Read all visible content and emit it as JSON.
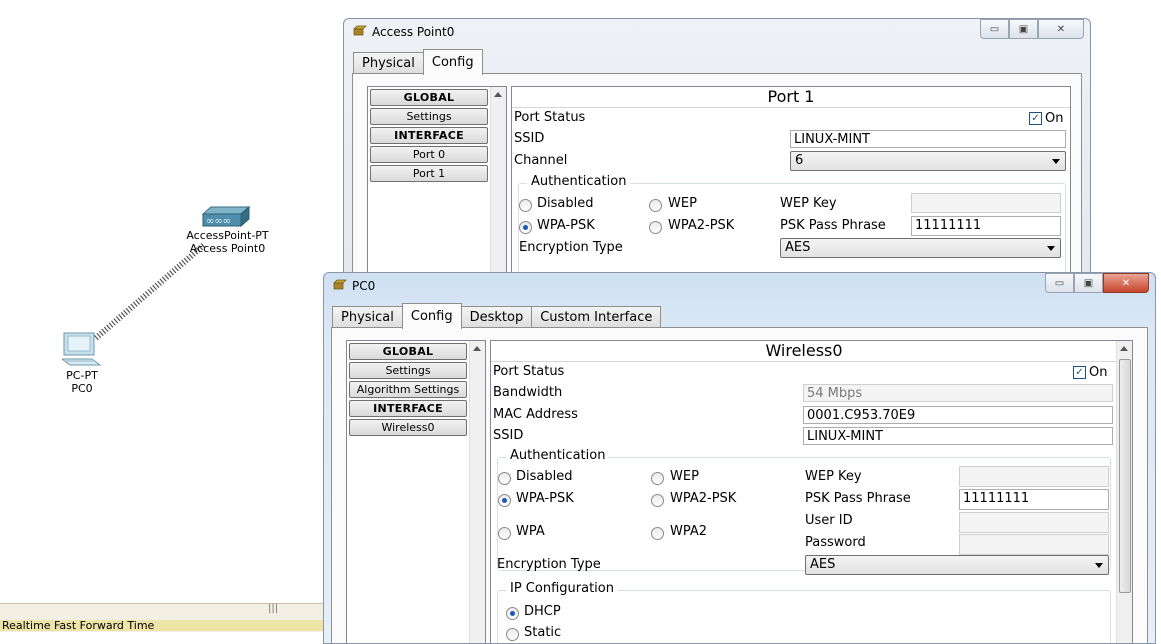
{
  "workspace": {
    "access_point_device": {
      "type_label": "AccessPoint-PT",
      "name_label": "Access Point0"
    },
    "pc_device": {
      "type_label": "PC-PT",
      "name_label": "PC0"
    },
    "statusbar_text": "Realtime  Fast Forward Time"
  },
  "ap_window": {
    "title": "Access Point0",
    "tabs": [
      "Physical",
      "Config"
    ],
    "left_list": {
      "global": "GLOBAL",
      "settings": "Settings",
      "interface": "INTERFACE",
      "port0": "Port 0",
      "port1": "Port 1"
    },
    "panel_title": "Port 1",
    "port_status_label": "Port Status",
    "on_label": "On",
    "ssid_label": "SSID",
    "ssid_value": "LINUX-MINT",
    "channel_label": "Channel",
    "channel_value": "6",
    "auth_legend": "Authentication",
    "disabled_label": "Disabled",
    "wep_label": "WEP",
    "wep_key_label": "WEP Key",
    "wpa_psk_label": "WPA-PSK",
    "wpa2_psk_label": "WPA2-PSK",
    "psk_label": "PSK Pass Phrase",
    "psk_value": "11111111",
    "enc_label": "Encryption Type",
    "enc_value": "AES"
  },
  "pc_window": {
    "title": "PC0",
    "tabs": [
      "Physical",
      "Config",
      "Desktop",
      "Custom Interface"
    ],
    "left_list": {
      "global": "GLOBAL",
      "settings": "Settings",
      "algorithm": "Algorithm Settings",
      "interface": "INTERFACE",
      "wireless0": "Wireless0"
    },
    "panel_title": "Wireless0",
    "port_status_label": "Port Status",
    "on_label": "On",
    "bandwidth_label": "Bandwidth",
    "bandwidth_value": "54 Mbps",
    "mac_label": "MAC Address",
    "mac_value": "0001.C953.70E9",
    "ssid_label": "SSID",
    "ssid_value": "LINUX-MINT",
    "auth_legend": "Authentication",
    "disabled_label": "Disabled",
    "wep_label": "WEP",
    "wep_key_label": "WEP Key",
    "wpa_psk_label": "WPA-PSK",
    "wpa2_psk_label": "WPA2-PSK",
    "psk_label": "PSK Pass Phrase",
    "psk_value": "11111111",
    "wpa_label": "WPA",
    "wpa2_label": "WPA2",
    "user_id_label": "User ID",
    "password_label": "Password",
    "enc_label": "Encryption Type",
    "enc_value": "AES",
    "ip_legend": "IP Configuration",
    "dhcp_label": "DHCP",
    "static_label": "Static"
  },
  "icons": [
    "access-point-icon",
    "pc-icon",
    "minimize-icon",
    "maximize-icon",
    "close-icon"
  ],
  "colors": {
    "selected_radio": "#1a57b8",
    "pc_titlebar": "#cfe0f2",
    "close_button": "#c8452c"
  }
}
